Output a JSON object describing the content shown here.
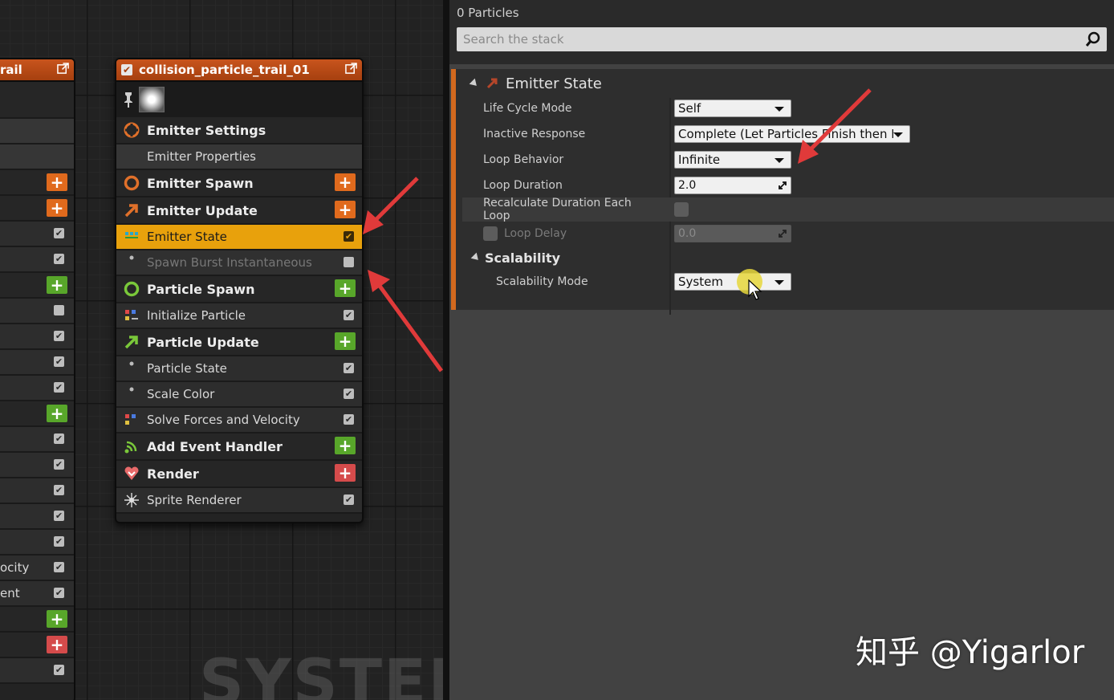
{
  "graph": {
    "watermark": "SYSTEM",
    "left_node": {
      "title": "rail",
      "rows": [
        "",
        "",
        "",
        "",
        "",
        "",
        "",
        "",
        "",
        "",
        "",
        "",
        "",
        "",
        "",
        "",
        "",
        "",
        "",
        "ocity",
        "ent",
        "",
        "",
        ""
      ]
    },
    "node": {
      "title": "collision_particle_trail_01",
      "groups": [
        {
          "label": "Emitter Settings",
          "kind": "group",
          "icon": "emitter-settings-icon",
          "color": "#e0702a"
        },
        {
          "label": "Emitter Properties",
          "kind": "sub"
        },
        {
          "label": "Emitter Spawn",
          "kind": "group",
          "icon": "emitter-spawn-icon",
          "add": "orange"
        },
        {
          "label": "Emitter Update",
          "kind": "group",
          "icon": "emitter-update-icon",
          "add": "orange"
        },
        {
          "label": "Emitter State",
          "kind": "module",
          "icon": "emitter-state-icon",
          "checked": true,
          "selected": true
        },
        {
          "label": "Spawn Burst Instantaneous",
          "kind": "module",
          "icon": "dot-icon",
          "checked": false,
          "dimmed": true
        },
        {
          "label": "Particle Spawn",
          "kind": "group",
          "icon": "particle-spawn-icon",
          "add": "green"
        },
        {
          "label": "Initialize Particle",
          "kind": "module",
          "icon": "initialize-particle-icon",
          "checked": true
        },
        {
          "label": "Particle Update",
          "kind": "group",
          "icon": "particle-update-icon",
          "add": "green"
        },
        {
          "label": "Particle State",
          "kind": "module",
          "icon": "dot-icon",
          "checked": true
        },
        {
          "label": "Scale Color",
          "kind": "module",
          "icon": "dot-icon",
          "checked": true
        },
        {
          "label": "Solve Forces and Velocity",
          "kind": "module",
          "icon": "solve-forces-icon",
          "checked": true
        },
        {
          "label": "Add Event Handler",
          "kind": "group",
          "icon": "event-handler-icon",
          "add": "green"
        },
        {
          "label": "Render",
          "kind": "group",
          "icon": "render-icon",
          "add": "red"
        },
        {
          "label": "Sprite Renderer",
          "kind": "module",
          "icon": "sprite-renderer-icon",
          "checked": true
        }
      ]
    }
  },
  "panel": {
    "particles_count": "0 Particles",
    "search_placeholder": "Search the stack",
    "section_title": "Emitter State",
    "properties": [
      {
        "name": "Life Cycle Mode",
        "type": "combo",
        "value": "Self"
      },
      {
        "name": "Inactive Response",
        "type": "combo",
        "value": "Complete (Let Particles Finish then K"
      },
      {
        "name": "Loop Behavior",
        "type": "combo",
        "value": "Infinite"
      },
      {
        "name": "Loop Duration",
        "type": "number",
        "value": "2.0"
      },
      {
        "name": "Recalculate Duration Each Loop",
        "type": "checkbox",
        "value": false
      },
      {
        "name": "Loop Delay",
        "type": "number",
        "value": "0.0",
        "disabled": true
      }
    ],
    "subsection_title": "Scalability",
    "scalability_mode": {
      "name": "Scalability Mode",
      "value": "System"
    }
  },
  "watermark": "知乎 @Yigarlor",
  "colors": {
    "accent": "#d2691e",
    "selected": "#e8a10c",
    "add_orange": "#e06a1d",
    "add_green": "#58a62a",
    "add_red": "#d54b4b",
    "arrow": "#e03a3a"
  }
}
